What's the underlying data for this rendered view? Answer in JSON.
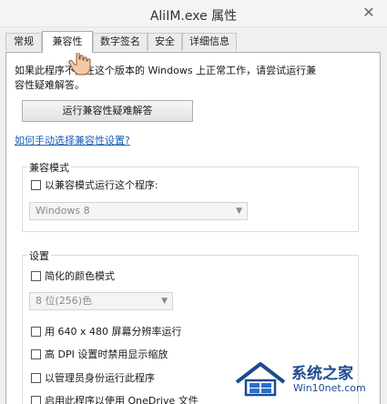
{
  "window": {
    "title": "AliIM.exe 属性",
    "close_glyph": "✕"
  },
  "tabs": [
    {
      "label": "常规",
      "active": false
    },
    {
      "label": "兼容性",
      "active": true
    },
    {
      "label": "数字签名",
      "active": false
    },
    {
      "label": "安全",
      "active": false
    },
    {
      "label": "详细信息",
      "active": false
    }
  ],
  "compat": {
    "description_line1": "如果此程序不能在这个版本的 Windows 上正常工作，请尝试运行兼",
    "description_line2": "容性疑难解答。",
    "troubleshoot_button": "运行兼容性疑难解答",
    "manual_link": "如何手动选择兼容性设置?"
  },
  "compat_mode": {
    "group_label": "兼容模式",
    "checkbox_label": "以兼容模式运行这个程序:",
    "checked": false,
    "os_select_value": "Windows 8"
  },
  "settings": {
    "group_label": "设置",
    "reduced_color_label": "简化的颜色模式",
    "reduced_color_checked": false,
    "color_select_value": "8 位(256)色",
    "run_640_label": "用 640 x 480 屏幕分辨率运行",
    "high_dpi_label": "高 DPI 设置时禁用显示缩放",
    "admin_label": "以管理员身份运行此程序",
    "onedrive_label": "启用此程序以使用 OneDrive 文件"
  },
  "watermark": {
    "name": "系统之家",
    "url": "Win10net.com"
  },
  "colors": {
    "link": "#1a5eb8",
    "watermark": "#1c4b8f"
  }
}
